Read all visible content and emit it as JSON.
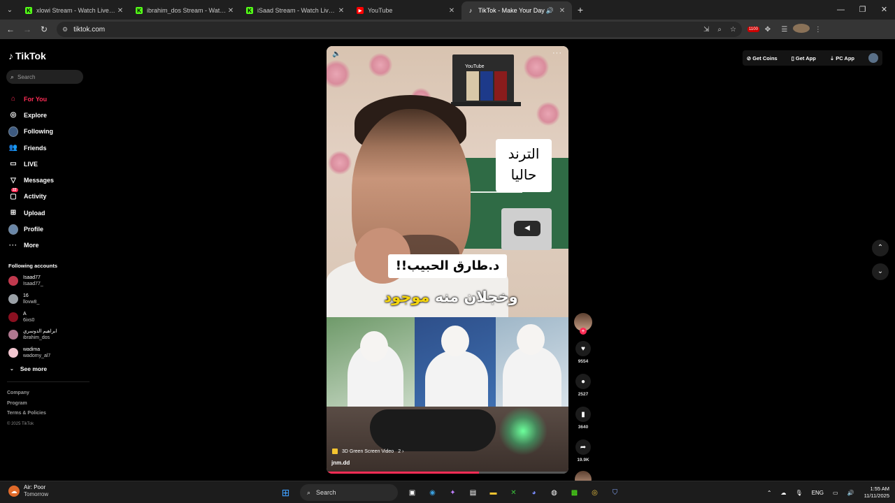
{
  "browser": {
    "tabs": [
      {
        "title": "xlowi Stream - Watch Live on Ki",
        "favicon": "kick-icon"
      },
      {
        "title": "ibrahim_dos Stream - Watch Live",
        "favicon": "kick-icon"
      },
      {
        "title": "iSaad Stream - Watch Live on K",
        "favicon": "kick-icon"
      },
      {
        "title": "YouTube",
        "favicon": "youtube-icon"
      },
      {
        "title": "TikTok - Make Your Day",
        "favicon": "tiktok-icon",
        "active": true
      }
    ],
    "url": "tiktok.com",
    "extension_badge": "1100"
  },
  "sidebar": {
    "logo": "TikTok",
    "search_placeholder": "Search",
    "nav": [
      {
        "label": "For You",
        "icon": "home-icon",
        "active": true
      },
      {
        "label": "Explore",
        "icon": "compass-icon"
      },
      {
        "label": "Following",
        "icon": "following-icon"
      },
      {
        "label": "Friends",
        "icon": "friends-icon"
      },
      {
        "label": "LIVE",
        "icon": "live-icon"
      },
      {
        "label": "Messages",
        "icon": "messages-icon"
      },
      {
        "label": "Activity",
        "icon": "activity-icon",
        "badge": "22"
      },
      {
        "label": "Upload",
        "icon": "upload-icon"
      },
      {
        "label": "Profile",
        "icon": "profile-icon"
      },
      {
        "label": "More",
        "icon": "more-icon"
      }
    ],
    "following_header": "Following accounts",
    "following": [
      {
        "name": "Isaad77",
        "handle": "Isaad77_",
        "color": "#c0394d"
      },
      {
        "name": "16",
        "handle": "llovw8_",
        "color": "#9aa0a6"
      },
      {
        "name": "A",
        "handle": "6ixs0",
        "color": "#8a1020"
      },
      {
        "name": "ابراهيم الدوسري",
        "handle": "ibrahim_dos",
        "color": "#b07890"
      },
      {
        "name": "wadima",
        "handle": "wadomy_al7",
        "color": "#f2c6d0"
      }
    ],
    "see_more": "See more",
    "footer": [
      "Company",
      "Program",
      "Terms & Policies"
    ],
    "copyright": "© 2025 TikTok"
  },
  "topbar": {
    "get_coins": "Get Coins",
    "get_app": "Get App",
    "pc_app": "PC App"
  },
  "video": {
    "youtube_label": "YouTube",
    "caption_top_line1": "الترند",
    "caption_top_line2": "حاليا",
    "caption_name": "د.طارق الحبيب!!",
    "caption_bottom_white": "وخجلان منه",
    "caption_bottom_yellow": "موجود",
    "tag": "3D Green Screen Video",
    "tag_count": "2",
    "author": "jnm.dd",
    "progress": 0.63
  },
  "actions": {
    "likes": "9554",
    "comments": "2527",
    "saves": "3640",
    "shares": "19.9K"
  },
  "taskbar": {
    "weather_line1": "Air: Poor",
    "weather_line2": "Tomorrow",
    "search": "Search",
    "lang": "ENG",
    "time": "1:55 AM",
    "date": "11/11/2025"
  }
}
